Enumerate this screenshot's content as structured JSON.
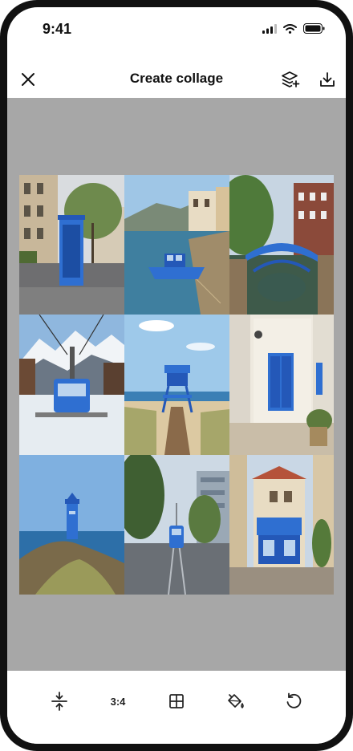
{
  "status_bar": {
    "time": "9:41"
  },
  "header": {
    "title": "Create collage"
  },
  "toolbar": {
    "ratio_label": "3:4"
  },
  "collage": {
    "photos": [
      "street-phone-booth",
      "harbor-blue-boat",
      "canal-blue-bridge",
      "mountain-cable-car",
      "beach-lifeguard-tower",
      "white-house-blue-door",
      "coast-lighthouse",
      "city-blue-tram",
      "village-blue-shopfront"
    ]
  },
  "icons": {
    "close": "close-icon",
    "layers": "layers-add-icon",
    "download": "download-icon",
    "spacing": "vertical-spacing-icon",
    "layout": "grid-layout-icon",
    "fill": "paint-bucket-icon",
    "reset": "undo-icon"
  },
  "colors": {
    "accent_blue": "#2f6fd1",
    "canvas_gray": "#a7a7a7"
  }
}
